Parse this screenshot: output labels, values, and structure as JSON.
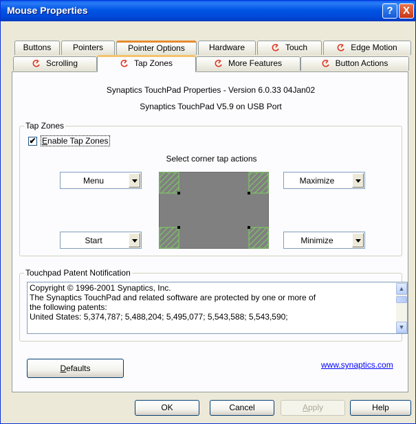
{
  "window": {
    "title": "Mouse Properties",
    "help_glyph": "?",
    "close_glyph": "X"
  },
  "tabs_row1": [
    "Buttons",
    "Pointers",
    "Pointer Options",
    "Hardware",
    "Touch",
    "Edge Motion"
  ],
  "tabs_row2": [
    "Scrolling",
    "Tap Zones",
    "More Features",
    "Button Actions"
  ],
  "active_tab": "Tap Zones",
  "header": {
    "line1": "Synaptics TouchPad Properties - Version 6.0.33 04Jan02",
    "line2": "Synaptics TouchPad V5.9 on USB Port"
  },
  "tapzones": {
    "group_label": "Tap Zones",
    "enable_label": "Enable Tap Zones",
    "enable_mnemonic": "E",
    "enable_rest": "nable Tap Zones",
    "enabled": true,
    "check_glyph": "✔",
    "select_label": "Select corner tap actions",
    "top_left": "Menu",
    "top_right": "Maximize",
    "bottom_left": "Start",
    "bottom_right": "Minimize"
  },
  "patent": {
    "group_label": "Touchpad Patent Notification",
    "lines": [
      "Copyright © 1996-2001 Synaptics, Inc.",
      "The Synaptics TouchPad and related software are protected by one or more of",
      "the following patents:",
      "United States: 5,374,787; 5,488,204; 5,495,077; 5,543,588; 5,543,590;"
    ],
    "scroll_up": "▲",
    "scroll_down": "▼"
  },
  "defaults_label": "Defaults",
  "defaults_mnemonic": "D",
  "defaults_rest": "efaults",
  "link": "www.synaptics.com",
  "buttons": {
    "ok": "OK",
    "cancel": "Cancel",
    "apply_mnemonic": "A",
    "apply_rest": "pply",
    "help": "Help"
  },
  "colors": {
    "titlebar": "#0055E5",
    "tab_highlight": "#F5C26A",
    "touchpad": "#808080",
    "zone_hatch": "#7CD160",
    "synaptics_icon": "#E0321E"
  }
}
